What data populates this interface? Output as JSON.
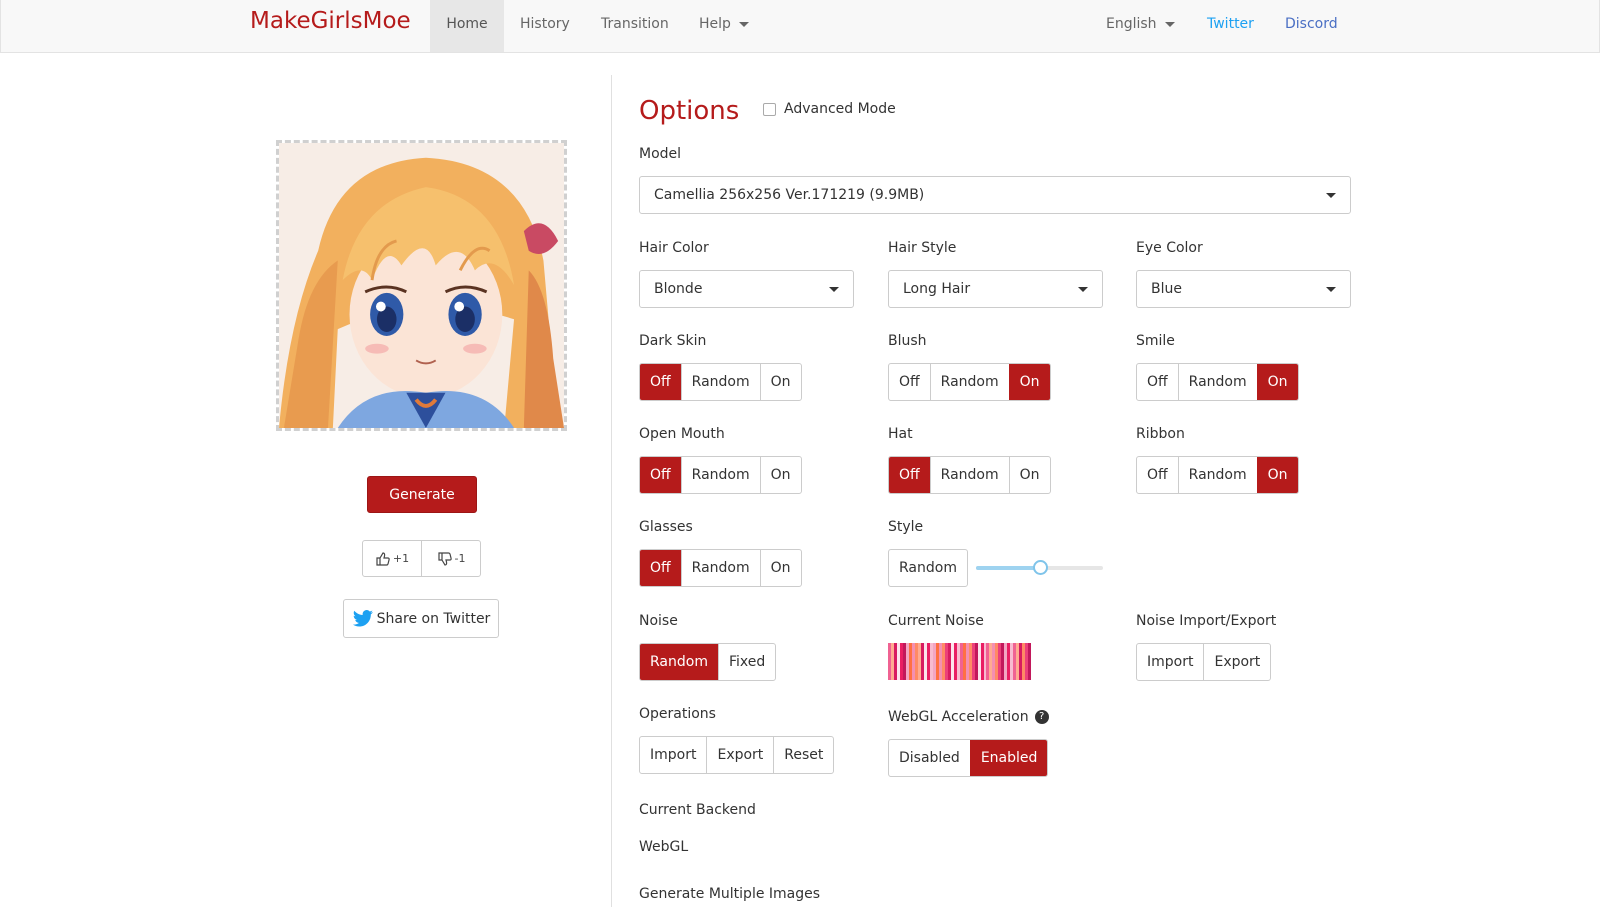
{
  "nav": {
    "brand": "MakeGirlsMoe",
    "items": [
      "Home",
      "History",
      "Transition",
      "Help"
    ],
    "language": "English",
    "twitter": "Twitter",
    "discord": "Discord"
  },
  "left": {
    "generate_label": "Generate",
    "upvote_label": "+1",
    "downvote_label": "-1",
    "share_label": "Share on Twitter"
  },
  "options": {
    "title": "Options",
    "advanced_mode_label": "Advanced Mode",
    "model_label": "Model",
    "model_value": "Camellia 256x256 Ver.171219 (9.9MB)",
    "hair_color_label": "Hair Color",
    "hair_color_value": "Blonde",
    "hair_style_label": "Hair Style",
    "hair_style_value": "Long Hair",
    "eye_color_label": "Eye Color",
    "eye_color_value": "Blue",
    "toggles": {
      "dark_skin": {
        "label": "Dark Skin",
        "options": [
          "Off",
          "Random",
          "On"
        ],
        "selected": "Off"
      },
      "blush": {
        "label": "Blush",
        "options": [
          "Off",
          "Random",
          "On"
        ],
        "selected": "On"
      },
      "smile": {
        "label": "Smile",
        "options": [
          "Off",
          "Random",
          "On"
        ],
        "selected": "On"
      },
      "open_mouth": {
        "label": "Open Mouth",
        "options": [
          "Off",
          "Random",
          "On"
        ],
        "selected": "Off"
      },
      "hat": {
        "label": "Hat",
        "options": [
          "Off",
          "Random",
          "On"
        ],
        "selected": "Off"
      },
      "ribbon": {
        "label": "Ribbon",
        "options": [
          "Off",
          "Random",
          "On"
        ],
        "selected": "On"
      },
      "glasses": {
        "label": "Glasses",
        "options": [
          "Off",
          "Random",
          "On"
        ],
        "selected": "Off"
      }
    },
    "style_label": "Style",
    "style_random": "Random",
    "style_slider_value": 0.5,
    "noise_label": "Noise",
    "noise_options": [
      "Random",
      "Fixed"
    ],
    "noise_selected": "Random",
    "current_noise_label": "Current Noise",
    "noise_import_export_label": "Noise Import/Export",
    "noise_import": "Import",
    "noise_export": "Export",
    "operations_label": "Operations",
    "operations": [
      "Import",
      "Export",
      "Reset"
    ],
    "webgl_label": "WebGL Acceleration",
    "webgl_options": [
      "Disabled",
      "Enabled"
    ],
    "webgl_selected": "Enabled",
    "backend_label": "Current Backend",
    "backend_value": "WebGL",
    "multi_label": "Generate Multiple Images"
  },
  "colors": {
    "accent": "#b51b1b",
    "twitter": "#1da1f2",
    "discord": "#4a6fc4",
    "slider": "#9ed3f0"
  }
}
